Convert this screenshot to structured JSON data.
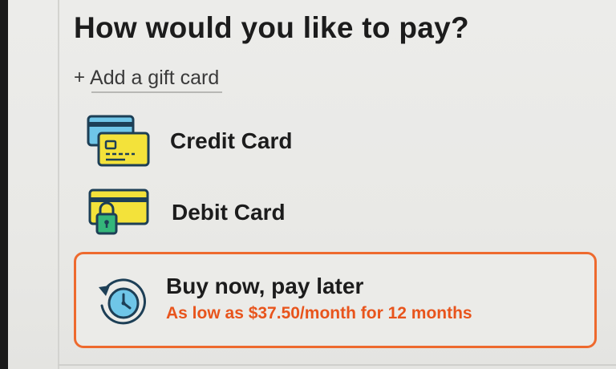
{
  "page": {
    "title": "How would you like to pay?"
  },
  "gift_card": {
    "plus": "+",
    "label": "Add a gift card"
  },
  "payment_options": [
    {
      "id": "credit",
      "label": "Credit Card",
      "icon": "credit-card-icon"
    },
    {
      "id": "debit",
      "label": "Debit Card",
      "icon": "debit-card-lock-icon"
    }
  ],
  "bnpl": {
    "label": "Buy now, pay later",
    "subtext": "As low as $37.50/month for 12 months",
    "icon": "clock-history-icon"
  },
  "colors": {
    "accent": "#ee6a2e",
    "accent_text": "#e8541c",
    "card_blue": "#6fc6e8",
    "card_yellow": "#f3e23a",
    "card_green": "#34b67a",
    "icon_dark": "#1d3f56"
  }
}
